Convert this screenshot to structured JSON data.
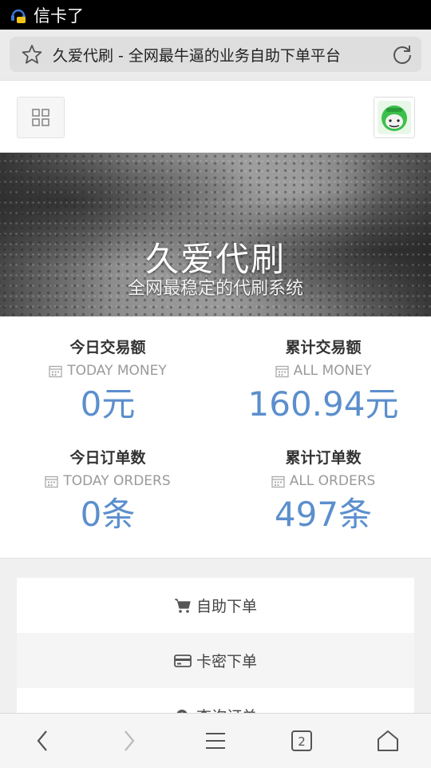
{
  "status_bar": {
    "carrier": "信卡了",
    "icon": "app-notify-icon"
  },
  "browser": {
    "page_title": "久爱代刷 - 全网最牛逼的业务自助下单平台",
    "tab_count": "2",
    "icons": [
      "star-icon",
      "refresh-icon",
      "back-icon",
      "forward-icon",
      "menu-icon",
      "tabs-icon",
      "home-icon"
    ]
  },
  "header": {
    "menu_icon": "grid-icon",
    "avatar_icon": "avatar-icon"
  },
  "hero": {
    "title": "久爱代刷",
    "subtitle": "全网最稳定的代刷系统"
  },
  "stats": [
    {
      "label": "今日交易额",
      "sub": "TODAY MONEY",
      "value": "0元"
    },
    {
      "label": "累计交易额",
      "sub": "ALL MONEY",
      "value": "160.94元"
    },
    {
      "label": "今日订单数",
      "sub": "TODAY ORDERS",
      "value": "0条"
    },
    {
      "label": "累计订单数",
      "sub": "ALL ORDERS",
      "value": "497条"
    }
  ],
  "menu": [
    {
      "label": "自助下单",
      "icon": "cart-icon"
    },
    {
      "label": "卡密下单",
      "icon": "credit-card-icon"
    },
    {
      "label": "查询订单",
      "icon": "search-icon"
    }
  ],
  "colors": {
    "accent": "#5b8fcd",
    "status_bar": "#000000",
    "address_bar": "#dedede"
  }
}
